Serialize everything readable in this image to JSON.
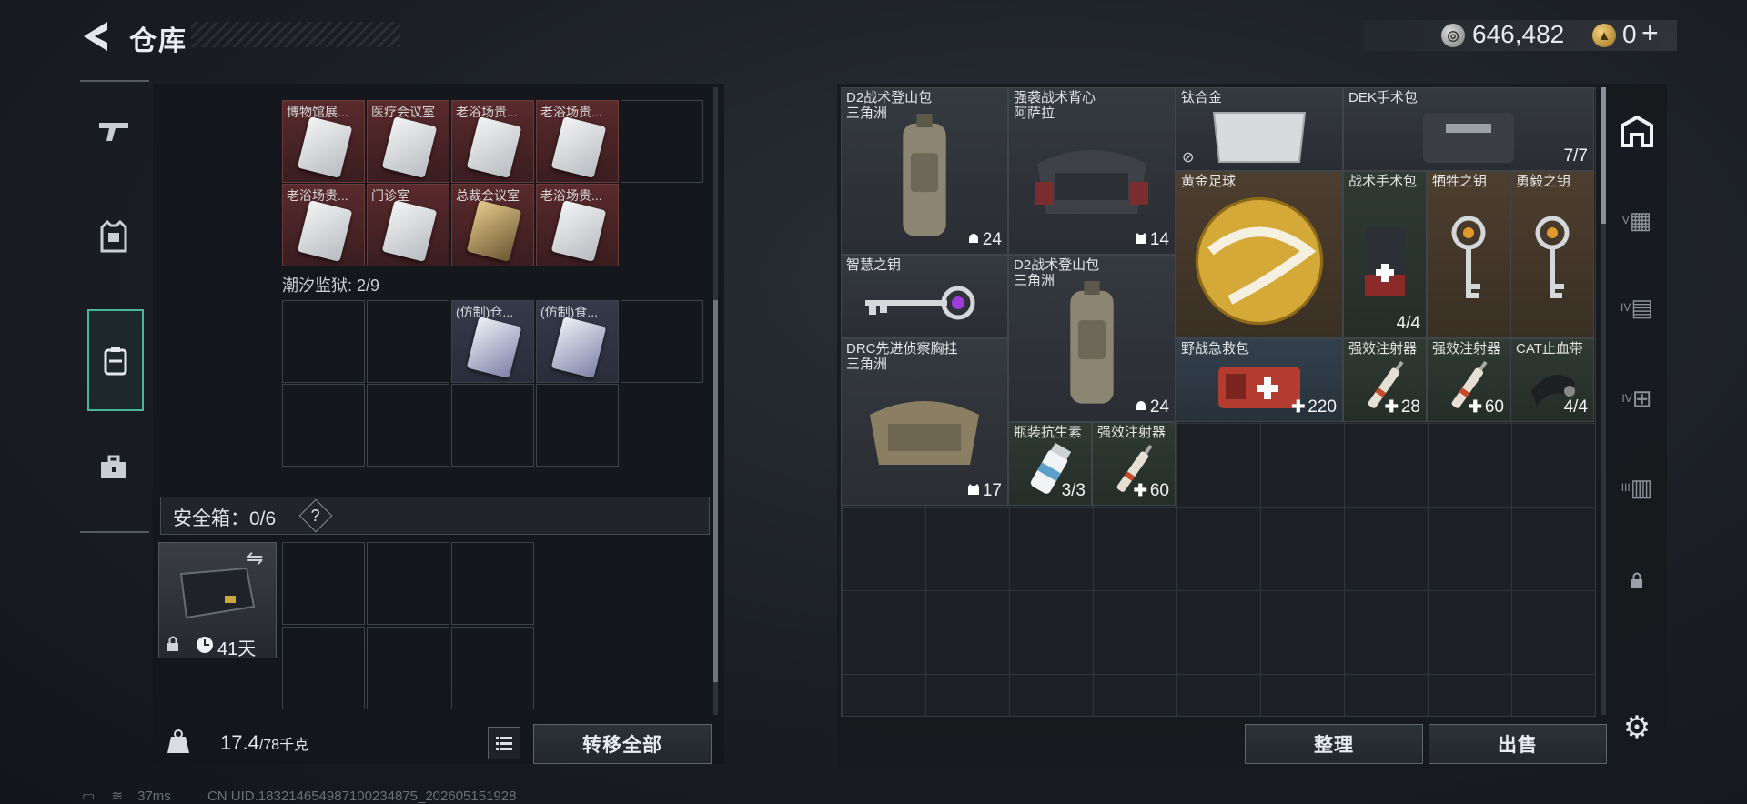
{
  "header": {
    "title": "仓库",
    "currency_silver": "646,482",
    "currency_gold": "0"
  },
  "left_nav": [
    "weapon-icon",
    "armor-icon",
    "backpack-icon",
    "toolbox-icon"
  ],
  "left_panel": {
    "cut_section_title": "...",
    "rows_top": [
      [
        "博物馆展...",
        "医疗会议室",
        "老浴场贵...",
        "老浴场贵..."
      ],
      [
        "老浴场贵...",
        "门诊室",
        "总裁会议室",
        "老浴场贵..."
      ]
    ],
    "prison_title": "潮汐监狱: 2/9",
    "prison_items": [
      "(仿制)仓...",
      "(仿制)食..."
    ],
    "safe_label": "安全箱：0/6",
    "help_symbol": "?",
    "safe_duration": "41天",
    "weight_value": "17.4",
    "weight_max": "/78千克",
    "transfer_all": "转移全部"
  },
  "right_panel": {
    "items": [
      {
        "name": "D2战术登山包\n三角洲",
        "count": "24",
        "count_icon": "helmet"
      },
      {
        "name": "强袭战术背心\n阿萨拉",
        "count": "14",
        "count_icon": "vest"
      },
      {
        "name": "钛合金",
        "count": "",
        "count_icon": "tile-icon"
      },
      {
        "name": "DEK手术包",
        "count": "7/7"
      },
      {
        "name": "黄金足球",
        "count": ""
      },
      {
        "name": "战术手术包",
        "count": "4/4"
      },
      {
        "name": "牺牲之钥",
        "count": ""
      },
      {
        "name": "勇毅之钥",
        "count": ""
      },
      {
        "name": "智慧之钥",
        "count": ""
      },
      {
        "name": "D2战术登山包\n三角洲",
        "count": "24",
        "count_icon": "helmet"
      },
      {
        "name": "DRC先进侦察胸挂\n三角洲",
        "count": "17",
        "count_icon": "vest"
      },
      {
        "name": "野战急救包",
        "count": "220",
        "count_icon": "plus"
      },
      {
        "name": "强效注射器",
        "count": "28",
        "count_icon": "plus"
      },
      {
        "name": "强效注射器",
        "count": "60",
        "count_icon": "plus"
      },
      {
        "name": "CAT止血带",
        "count": "4/4"
      },
      {
        "name": "瓶装抗生素",
        "count": "3/3"
      },
      {
        "name": "强效注射器",
        "count": "60",
        "count_icon": "plus"
      }
    ],
    "sort_button": "整理",
    "sell_button": "出售"
  },
  "right_nav": [
    "home-icon",
    "V-case-icon",
    "IV-case-icon",
    "IV-medical-icon",
    "III-case-icon",
    "lock-icon"
  ],
  "right_nav_labels": [
    "V",
    "IV",
    "IV",
    "III"
  ],
  "status": {
    "ping": "37ms",
    "uid": "CN UID.1832146549871002348​75_202605151928"
  }
}
